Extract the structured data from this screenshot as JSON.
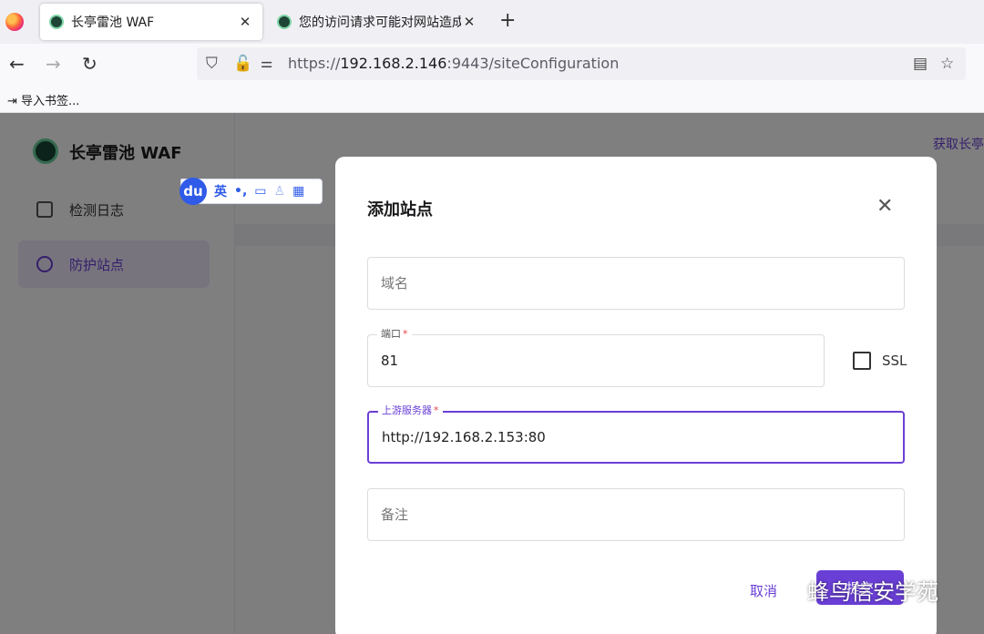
{
  "browser": {
    "tabs": [
      {
        "title": "长亭雷池 WAF",
        "active": true
      },
      {
        "title": "您的访问请求可能对网站造成安",
        "active": false
      }
    ],
    "url": {
      "prefix": "https://",
      "host": "192.168.2.146",
      "rest": ":9443/siteConfiguration"
    },
    "bookmarks": {
      "import_label": "导入书签..."
    }
  },
  "app": {
    "brand": "长亭雷池 WAF",
    "nav": [
      {
        "label": "检测日志",
        "icon": "log-icon",
        "selected": false
      },
      {
        "label": "防护站点",
        "icon": "site-icon",
        "selected": true
      }
    ],
    "header_link": "获取长亭"
  },
  "ime": {
    "logo": "du",
    "mode": "英",
    "punct": "•,"
  },
  "modal": {
    "title": "添加站点",
    "domain": {
      "placeholder": "域名",
      "value": ""
    },
    "port": {
      "label": "端口",
      "value": "81"
    },
    "ssl_label": "SSL",
    "upstream": {
      "label": "上游服务器",
      "value": "http://192.168.2.153:80"
    },
    "note": {
      "placeholder": "备注",
      "value": ""
    },
    "cancel_label": "取消",
    "submit_label": "提交"
  },
  "watermark": {
    "text": "蜂鸟信安学苑"
  }
}
